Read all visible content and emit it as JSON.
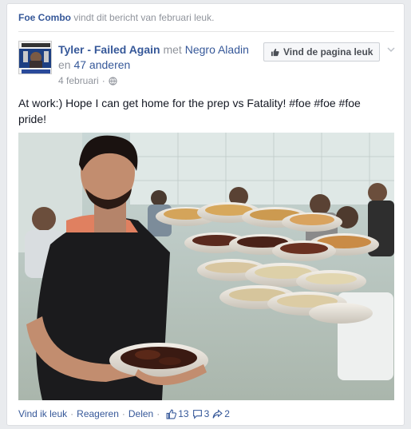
{
  "story": {
    "actor": "Foe Combo",
    "action": "vindt dit bericht van februari leuk."
  },
  "post": {
    "author": "Tyler - Failed Again",
    "with_word": "met",
    "tagged_user": "Negro Aladin",
    "and_word": "en",
    "others": "47 anderen",
    "date": "4 februari",
    "text": "At work:) Hope I can get home for the prep vs Fatality! #foe #foe #foe pride!",
    "like_page_label": "Vind de pagina leuk",
    "privacy_icon": "globe-icon"
  },
  "footer": {
    "like": "Vind ik leuk",
    "sep1": "·",
    "comment": "Reageren",
    "sep2": "·",
    "share": "Delen",
    "sep3": "·",
    "likes_count": "13",
    "comments_count": "3",
    "shares_count": "2"
  },
  "colors": {
    "link": "#365899",
    "muted": "#90949c",
    "text": "#141823",
    "background": "#e9ebee"
  }
}
